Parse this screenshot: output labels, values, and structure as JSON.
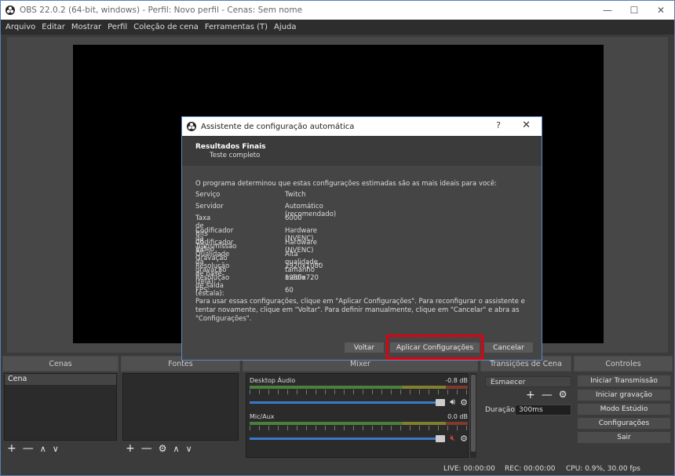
{
  "window": {
    "title": "OBS 22.0.2 (64-bit, windows) - Perfil: Novo perfil - Cenas: Sem nome"
  },
  "menu": [
    "Arquivo",
    "Editar",
    "Mostrar",
    "Perfil",
    "Coleção de cena",
    "Ferramentas (T)",
    "Ajuda"
  ],
  "docks": {
    "scenes": {
      "title": "Cenas",
      "items": [
        "Cena"
      ]
    },
    "sources": {
      "title": "Fontes"
    },
    "mixer": {
      "title": "Mixer",
      "channels": [
        {
          "name": "Desktop Áudio",
          "db": "-0.8 dB"
        },
        {
          "name": "Mic/Aux",
          "db": "0.0 dB"
        }
      ]
    },
    "transitions": {
      "title": "Transições de Cena",
      "selected": "Esmaecer",
      "duration_label": "Duração",
      "duration_value": "300ms"
    },
    "controls": {
      "title": "Controles",
      "buttons": [
        "Iniciar Transmissão",
        "Iniciar gravação",
        "Modo Estúdio",
        "Configurações",
        "Sair"
      ]
    }
  },
  "status": {
    "live": "LIVE: 00:00:00",
    "rec": "REC: 00:00:00",
    "cpu": "CPU: 0.9%, 30.00 fps"
  },
  "dialog": {
    "title": "Assistente de configuração automática",
    "help": "?",
    "header_title": "Resultados Finais",
    "header_sub": "Teste completo",
    "intro": "O programa determinou que estas configurações estimadas são as mais ideais para você:",
    "rows": [
      {
        "k": "Serviço",
        "v": "Twitch"
      },
      {
        "k": "Servidor",
        "v": "Automático (recomendado)"
      },
      {
        "k": "Taxa de Bits do Vídeo",
        "v": "6000"
      },
      {
        "k": "Codificador da Transmissão",
        "v": "Hardware (NVENC)"
      },
      {
        "k": "Codificador da Gravação",
        "v": "Hardware (NVENC)"
      },
      {
        "k": "Qualidade da gravação",
        "v": "Alta qualidade, tamanho médio"
      },
      {
        "k": "Resolução de base (tela):",
        "v": "1920x1080"
      },
      {
        "k": "Resolução de saída (escala):",
        "v": "1280x720"
      },
      {
        "k": "FPS:",
        "v": "60"
      }
    ],
    "note": "Para usar essas configurações, clique em \"Aplicar Configurações\". Para reconfigurar o assistente e tentar novamente, clique em \"Voltar\". Para definir manualmente, clique em \"Cancelar\" e abra as \"Configurações\".",
    "buttons": {
      "back": "Voltar",
      "apply": "Aplicar Configurações",
      "cancel": "Cancelar"
    }
  }
}
